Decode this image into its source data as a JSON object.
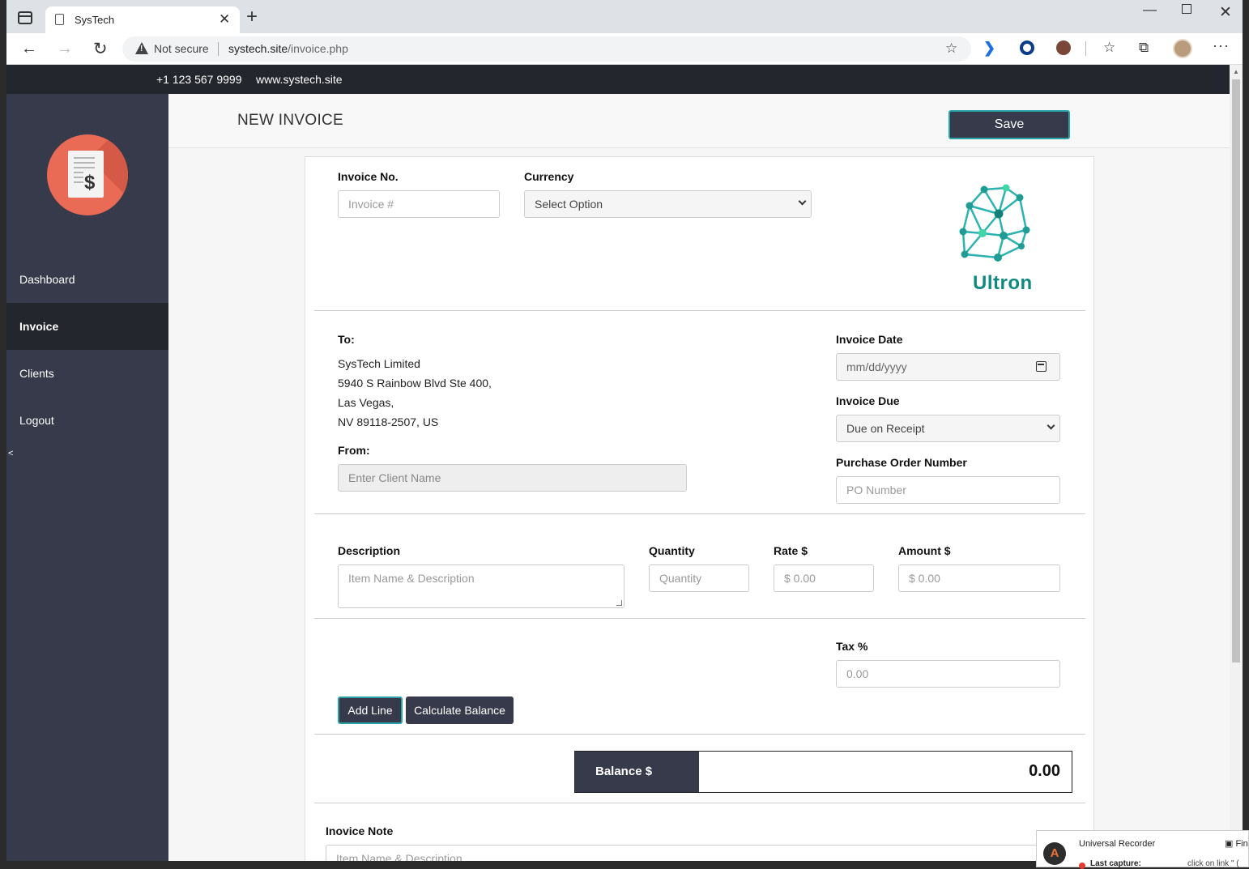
{
  "browser": {
    "tab_title": "SysTech",
    "security_label": "Not secure",
    "url_host": "systech.site",
    "url_path": "/invoice.php"
  },
  "topbar": {
    "phone": "+1 123 567 9999",
    "website": "www.systech.site"
  },
  "sidebar": {
    "items": [
      {
        "label": "Dashboard",
        "active": false
      },
      {
        "label": "Invoice",
        "active": true
      },
      {
        "label": "Clients",
        "active": false
      },
      {
        "label": "Logout",
        "active": false
      }
    ],
    "collapse_label": "<"
  },
  "header": {
    "title": "NEW INVOICE",
    "save_label": "Save"
  },
  "invoice": {
    "invoice_no": {
      "label": "Invoice No.",
      "placeholder": "Invoice #"
    },
    "currency": {
      "label": "Currency",
      "selected": "Select Option"
    },
    "company_logo_text": "Ultron",
    "to": {
      "label": "To:",
      "lines": [
        "SysTech Limited",
        "5940 S Rainbow Blvd Ste 400,",
        "Las Vegas,",
        "NV 89118-2507, US"
      ]
    },
    "from": {
      "label": "From:",
      "placeholder": "Enter Client Name"
    },
    "invoice_date": {
      "label": "Invoice Date",
      "placeholder": "mm/dd/yyyy"
    },
    "invoice_due": {
      "label": "Invoice Due",
      "selected": "Due on Receipt"
    },
    "po_number": {
      "label": "Purchase Order Number",
      "placeholder": "PO Number"
    },
    "line_item": {
      "description": {
        "label": "Description",
        "placeholder": "Item Name & Description"
      },
      "quantity": {
        "label": "Quantity",
        "placeholder": "Quantity"
      },
      "rate": {
        "label": "Rate $",
        "placeholder": "$ 0.00"
      },
      "amount": {
        "label": "Amount $",
        "placeholder": "$ 0.00"
      }
    },
    "tax": {
      "label": "Tax %",
      "placeholder": "0.00"
    },
    "add_line_label": "Add Line",
    "calculate_label": "Calculate Balance",
    "balance": {
      "label": "Balance $",
      "value": "0.00"
    },
    "note": {
      "label": "Inovice Note",
      "placeholder": "Item Name & Description"
    }
  },
  "recorder": {
    "title": "Universal Recorder",
    "find_label": "Fin",
    "last_capture_label": "Last capture:",
    "last_capture_value": "click on link \" ("
  }
}
